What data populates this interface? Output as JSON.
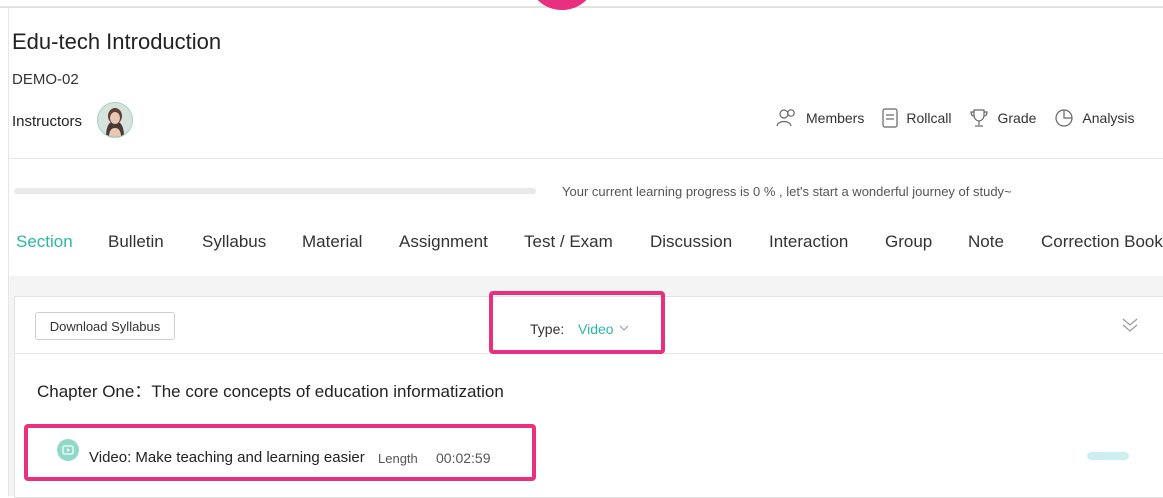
{
  "course": {
    "title": "Edu-tech Introduction",
    "code": "DEMO-02",
    "instructors_label": "Instructors"
  },
  "actions": [
    {
      "label": "Members",
      "icon": "members-icon"
    },
    {
      "label": "Rollcall",
      "icon": "rollcall-icon"
    },
    {
      "label": "Grade",
      "icon": "trophy-icon"
    },
    {
      "label": "Analysis",
      "icon": "pie-chart-icon"
    }
  ],
  "progress": {
    "value_percent": 0,
    "text": "Your current learning progress is 0 % , let's start a wonderful journey of study~"
  },
  "tabs": [
    "Section",
    "Bulletin",
    "Syllabus",
    "Material",
    "Assignment",
    "Test / Exam",
    "Discussion",
    "Interaction",
    "Group",
    "Note",
    "Correction Book"
  ],
  "active_tab": "Section",
  "toolbar": {
    "download_label": "Download Syllabus",
    "type_label": "Type:",
    "type_value": "Video"
  },
  "chapter": {
    "title": "Chapter One：The core concepts of education informatization",
    "items": [
      {
        "title": "Video: Make teaching and learning easier",
        "length_label": "Length",
        "length": "00:02:59"
      }
    ]
  },
  "colors": {
    "accent": "#2bb7a8",
    "highlight": "#e8307e"
  }
}
